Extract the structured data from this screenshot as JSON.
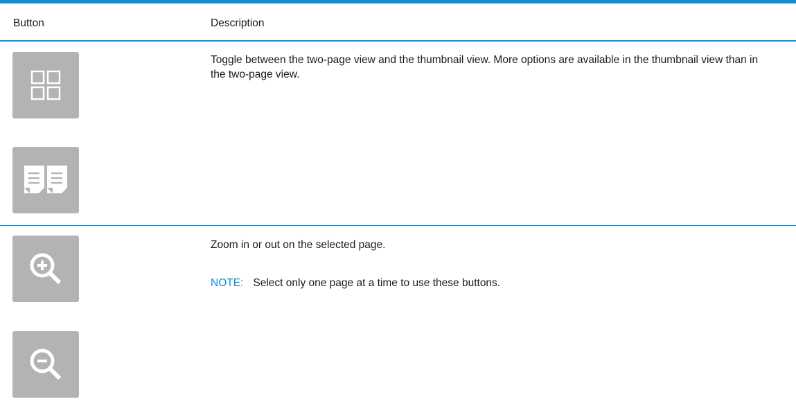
{
  "table": {
    "headers": {
      "button": "Button",
      "description": "Description"
    },
    "rows": [
      {
        "icons": [
          "thumbnail-view-icon",
          "two-page-view-icon"
        ],
        "description": "Toggle between the two-page view and the thumbnail view. More options are available in the thumbnail view than in the two-page view."
      },
      {
        "icons": [
          "zoom-in-icon",
          "zoom-out-icon"
        ],
        "description": "Zoom in or out on the selected page.",
        "note_label": "NOTE:",
        "note_text": "Select only one page at a time to use these buttons."
      }
    ]
  },
  "colors": {
    "accent": "#0a8fd6",
    "button_bg": "#b3b3b3",
    "icon": "#ffffff"
  }
}
